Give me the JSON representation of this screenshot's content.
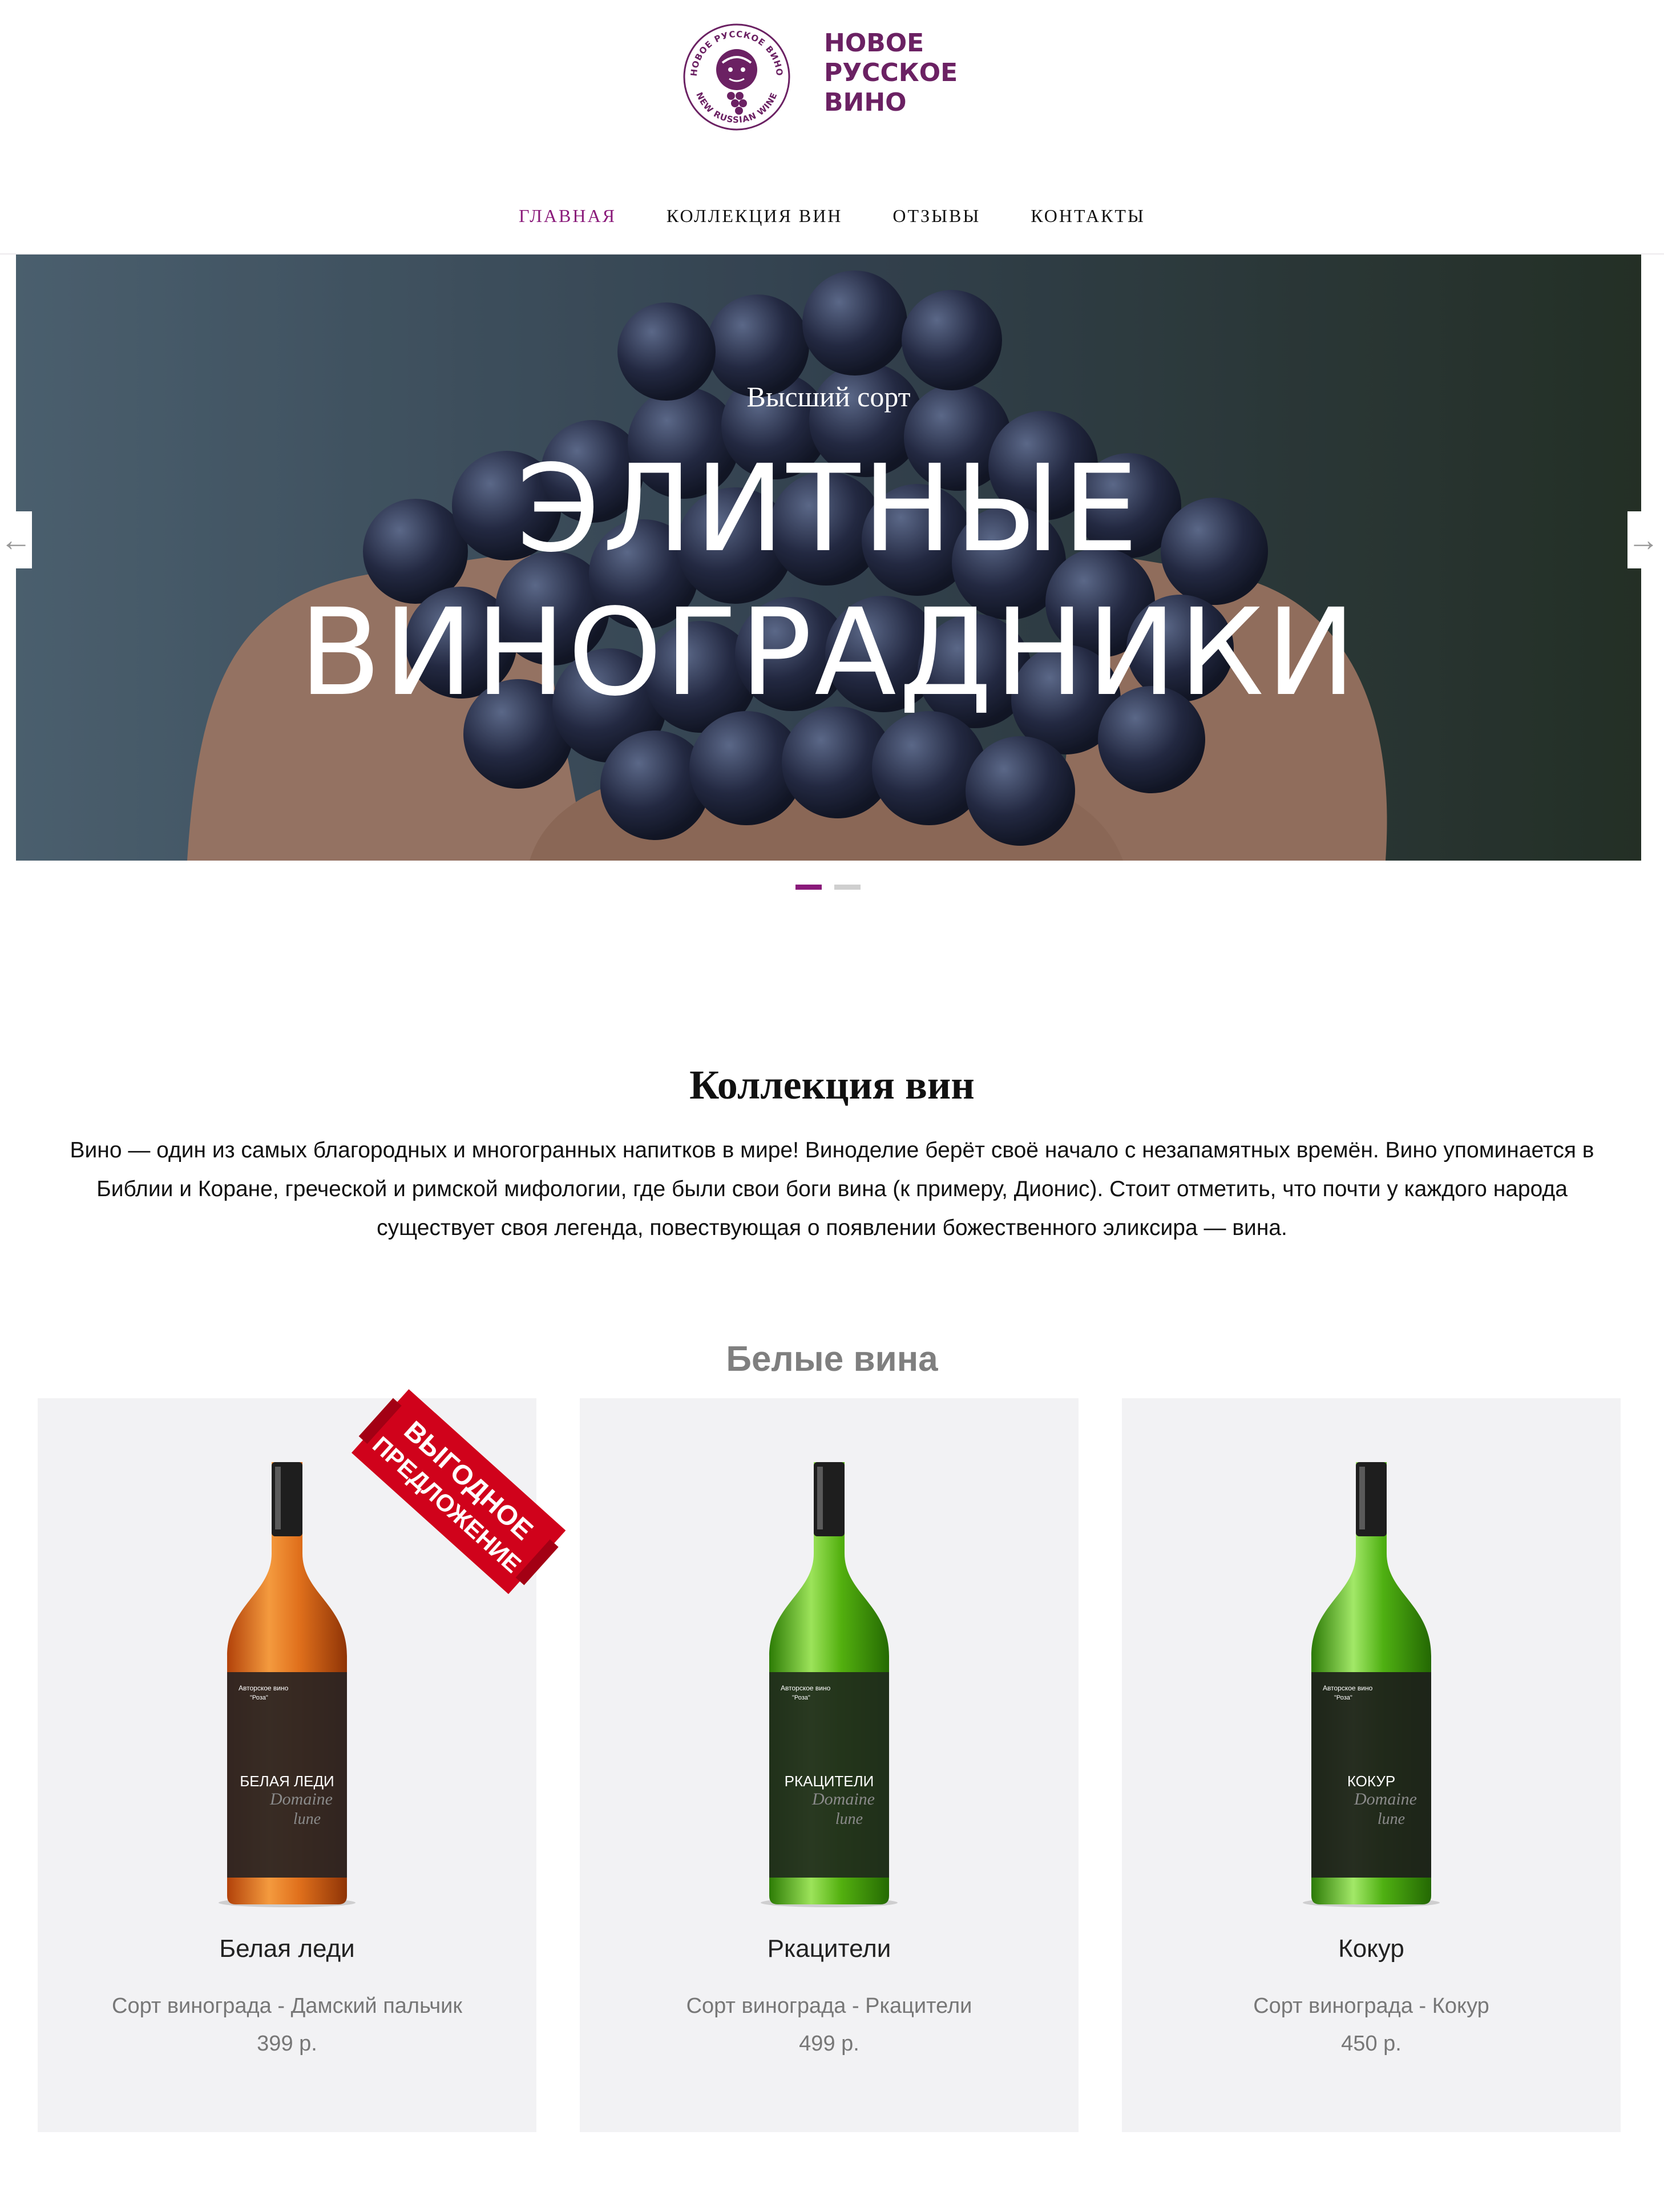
{
  "brand": {
    "name_lines": [
      "НОВОЕ",
      "РУССКОЕ",
      "ВИНО"
    ],
    "ring_text_top": "НОВОЕ РУССКОЕ ВИНО",
    "ring_text_bottom": "NEW RUSSIAN WINE",
    "color": "#6b2163"
  },
  "nav": {
    "items": [
      {
        "label": "ГЛАВНАЯ",
        "active": true
      },
      {
        "label": "КОЛЛЕКЦИЯ ВИН",
        "active": false
      },
      {
        "label": "ОТЗЫВЫ",
        "active": false
      },
      {
        "label": "КОНТАКТЫ",
        "active": false
      }
    ],
    "active_color": "#8a1a7a"
  },
  "hero": {
    "eyebrow": "Высший сорт",
    "title_lines": [
      "ЭЛИТНЫЕ",
      "ВИНОГРАДНИКИ"
    ],
    "prev_icon": "arrow-left-icon",
    "next_icon": "arrow-right-icon",
    "prev_glyph": "←",
    "next_glyph": "→",
    "slide_count": 2,
    "active_slide": 1
  },
  "collection": {
    "title": "Коллекция вин",
    "description": "Вино — один из самых благородных и многогранных напитков в мире! Виноделие берёт своё начало с незапамятных времён. Вино упоминается в Библии и Коране, греческой и римской мифологии, где были свои боги вина (к примеру, Дионис). Стоит отметить, что почти у каждого народа существует своя легенда, повествующая о появлении божественного эликсира — вина."
  },
  "white_wines": {
    "title": "Белые вина",
    "badge_lines": [
      "ВЫГОДНОЕ",
      "ПРЕДЛОЖЕНИЕ"
    ],
    "badge_color": "#d0021b",
    "products": [
      {
        "name": "Белая леди",
        "variety": "Сорт винограда - Дамский пальчик",
        "price": "399 р.",
        "label_top": "Авторское вино",
        "label_top2": "\"Роза\"",
        "label_name": "БЕЛАЯ ЛЕДИ",
        "label_script": "Domaine",
        "label_script2": "lune",
        "glass_color": "#e0701c"
      },
      {
        "name": "Ркацители",
        "variety": "Сорт винограда - Ркацители",
        "price": "499 р.",
        "label_top": "Авторское вино",
        "label_top2": "\"Роза\"",
        "label_name": "РКАЦИТЕЛИ",
        "label_script": "Domaine",
        "label_script2": "lune",
        "glass_color": "#53b00f"
      },
      {
        "name": "Кокур",
        "variety": "Сорт винограда - Кокур",
        "price": "450 р.",
        "label_top": "Авторское вино",
        "label_top2": "\"Роза\"",
        "label_name": "КОКУР",
        "label_script": "Domaine",
        "label_script2": "lune",
        "glass_color": "#4fb012"
      }
    ]
  }
}
